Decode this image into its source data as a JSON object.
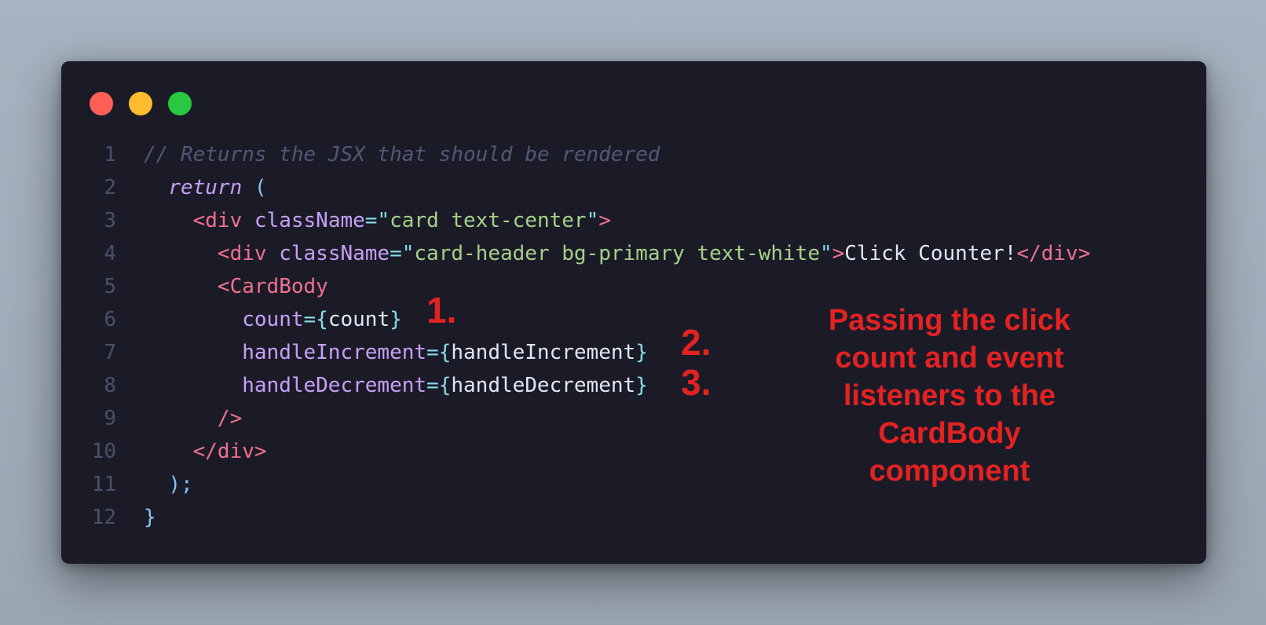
{
  "window": {
    "controls": [
      "close",
      "minimize",
      "maximize"
    ]
  },
  "code": {
    "lines": [
      {
        "n": "1",
        "indent": "",
        "tokens": [
          {
            "cls": "cm",
            "t": "// Returns the JSX that should be rendered"
          }
        ]
      },
      {
        "n": "2",
        "indent": "  ",
        "tokens": [
          {
            "cls": "kw",
            "t": "return"
          },
          {
            "cls": "tx",
            "t": " "
          },
          {
            "cls": "pn",
            "t": "("
          }
        ]
      },
      {
        "n": "3",
        "indent": "    ",
        "tokens": [
          {
            "cls": "tg",
            "t": "<div"
          },
          {
            "cls": "tx",
            "t": " "
          },
          {
            "cls": "at",
            "t": "className"
          },
          {
            "cls": "eq",
            "t": "=\""
          },
          {
            "cls": "st",
            "t": "card text-center"
          },
          {
            "cls": "eq",
            "t": "\""
          },
          {
            "cls": "tg",
            "t": ">"
          }
        ]
      },
      {
        "n": "4",
        "indent": "      ",
        "tokens": [
          {
            "cls": "tg",
            "t": "<div"
          },
          {
            "cls": "tx",
            "t": " "
          },
          {
            "cls": "at",
            "t": "className"
          },
          {
            "cls": "eq",
            "t": "=\""
          },
          {
            "cls": "st",
            "t": "card-header bg-primary text-white"
          },
          {
            "cls": "eq",
            "t": "\""
          },
          {
            "cls": "tg",
            "t": ">"
          },
          {
            "cls": "tx",
            "t": "Click Counter!"
          },
          {
            "cls": "tg",
            "t": "</div>"
          }
        ]
      },
      {
        "n": "5",
        "indent": "      ",
        "tokens": [
          {
            "cls": "tg",
            "t": "<CardBody"
          }
        ]
      },
      {
        "n": "6",
        "indent": "        ",
        "tokens": [
          {
            "cls": "at",
            "t": "count"
          },
          {
            "cls": "eq",
            "t": "={"
          },
          {
            "cls": "tx",
            "t": "count"
          },
          {
            "cls": "eq",
            "t": "}"
          }
        ]
      },
      {
        "n": "7",
        "indent": "        ",
        "tokens": [
          {
            "cls": "at",
            "t": "handleIncrement"
          },
          {
            "cls": "eq",
            "t": "={"
          },
          {
            "cls": "tx",
            "t": "handleIncrement"
          },
          {
            "cls": "eq",
            "t": "}"
          }
        ]
      },
      {
        "n": "8",
        "indent": "        ",
        "tokens": [
          {
            "cls": "at",
            "t": "handleDecrement"
          },
          {
            "cls": "eq",
            "t": "={"
          },
          {
            "cls": "tx",
            "t": "handleDecrement"
          },
          {
            "cls": "eq",
            "t": "}"
          }
        ]
      },
      {
        "n": "9",
        "indent": "      ",
        "tokens": [
          {
            "cls": "tg",
            "t": "/>"
          }
        ]
      },
      {
        "n": "10",
        "indent": "    ",
        "tokens": [
          {
            "cls": "tg",
            "t": "</div>"
          }
        ]
      },
      {
        "n": "11",
        "indent": "  ",
        "tokens": [
          {
            "cls": "pn",
            "t": ");"
          }
        ]
      },
      {
        "n": "12",
        "indent": "",
        "tokens": [
          {
            "cls": "pn",
            "t": "}"
          }
        ]
      }
    ]
  },
  "markers": {
    "one": "1.",
    "two": "2.",
    "three": "3."
  },
  "annotation": {
    "text": "Passing the click count and event listeners to the CardBody component"
  },
  "colors": {
    "background": "#a7b3c0",
    "editor": "#1b1b28",
    "annotation": "#e32222",
    "close": "#ff5f57",
    "minimize": "#febc2e",
    "maximize": "#28c840"
  }
}
